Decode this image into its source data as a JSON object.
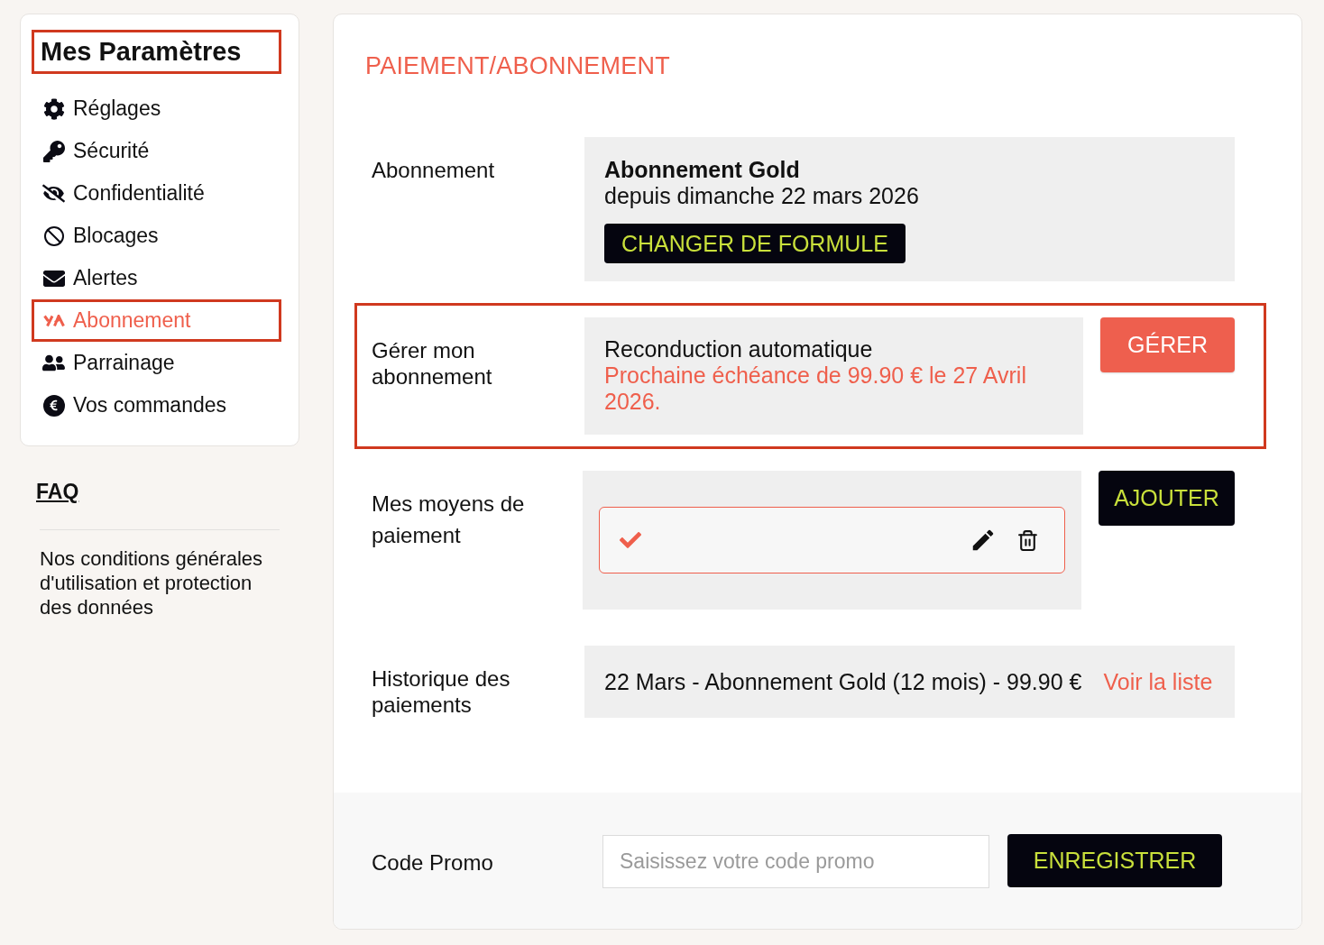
{
  "sidebar": {
    "title": {
      "text": "Mes Paramètres",
      "highlighted": true
    },
    "items": [
      {
        "label": "Réglages",
        "selected": false
      },
      {
        "label": "Sécurité",
        "selected": false
      },
      {
        "label": "Confidentialité",
        "selected": false
      },
      {
        "label": "Blocages",
        "selected": false
      },
      {
        "label": "Alertes",
        "selected": false
      },
      {
        "label": "Abonnement",
        "selected": true
      },
      {
        "label": "Parrainage",
        "selected": false
      },
      {
        "label": "Vos commandes",
        "selected": false
      }
    ],
    "faq": "FAQ",
    "terms": "Nos conditions générales d'utilisation et protection des données"
  },
  "main": {
    "heading": "PAIEMENT/ABONNEMENT",
    "rows": [
      {
        "kind": "plan",
        "label": "Abonnement",
        "highlighted": false,
        "title": "Abonnement Gold",
        "subtitle": "depuis dimanche 22 mars 2026",
        "button": "CHANGER DE FORMULE"
      },
      {
        "kind": "renewal",
        "label": "Gérer mon abonnement",
        "highlighted": true,
        "title": "Reconduction automatique",
        "note": "Prochaine échéance de 99.90 € le 27 Avril 2026.",
        "button": "GÉRER"
      },
      {
        "kind": "payment_methods",
        "label": "Mes moyens de paiement",
        "highlighted": false,
        "methods": [
          {
            "selected": true
          }
        ],
        "button": "AJOUTER"
      },
      {
        "kind": "history",
        "label": "Historique des paiements",
        "highlighted": false,
        "entry": "22 Mars - Abonnement Gold (12 mois) - 99.90 €",
        "link": "Voir la liste"
      }
    ],
    "promo": {
      "label": "Code Promo",
      "placeholder": "Saisissez votre code promo",
      "button": "ENREGISTRER"
    }
  }
}
